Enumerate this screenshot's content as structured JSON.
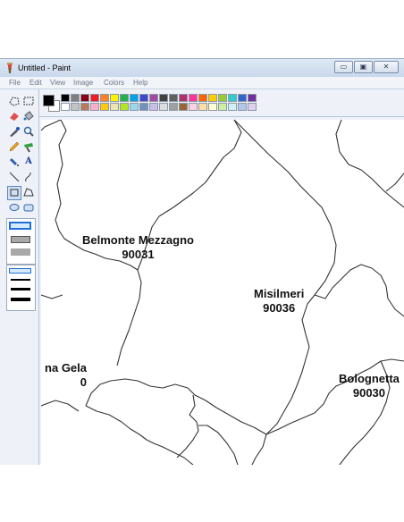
{
  "window": {
    "title": "Untitled - Paint",
    "buttons": {
      "minimize": "▭",
      "maximize": "▣",
      "close": "✕"
    }
  },
  "menu": [
    "File",
    "Edit",
    "View",
    "Image",
    "Colors",
    "Help"
  ],
  "tools": [
    "free-select",
    "rect-select",
    "eraser",
    "fill",
    "color-picker",
    "magnifier",
    "pencil",
    "brush",
    "airbrush",
    "text",
    "line",
    "curve",
    "rectangle",
    "polygon",
    "ellipse",
    "rounded-rectangle"
  ],
  "palette": {
    "row1": [
      "#000000",
      "#7f7f7f",
      "#880015",
      "#ed1c24",
      "#ff7f27",
      "#fff200",
      "#22b14c",
      "#00a2e8",
      "#3f48cc",
      "#a349a4",
      "#404040",
      "#606060",
      "#b0306a",
      "#ff3399",
      "#ff6600",
      "#ffcc00",
      "#99cc33",
      "#33cccc",
      "#3366cc",
      "#7030a0"
    ],
    "row2": [
      "#ffffff",
      "#c3c3c3",
      "#b97a57",
      "#ffaec9",
      "#ffc90e",
      "#efe4b0",
      "#b5e61d",
      "#99d9ea",
      "#7092be",
      "#c8bfe7",
      "#dcdcdc",
      "#a0a0a0",
      "#996633",
      "#ffd1e0",
      "#ffe0a0",
      "#ffffd0",
      "#ccf0a0",
      "#d0f0f8",
      "#b0c8e8",
      "#e0d0f0"
    ]
  },
  "map": {
    "labels": [
      {
        "name": "Belmonte Mezzagno",
        "code": "90031"
      },
      {
        "name": "Misilmeri",
        "code": "90036"
      },
      {
        "name": "na Gela",
        "code": "0"
      },
      {
        "name": "Bolognetta",
        "code": "90030"
      }
    ]
  }
}
